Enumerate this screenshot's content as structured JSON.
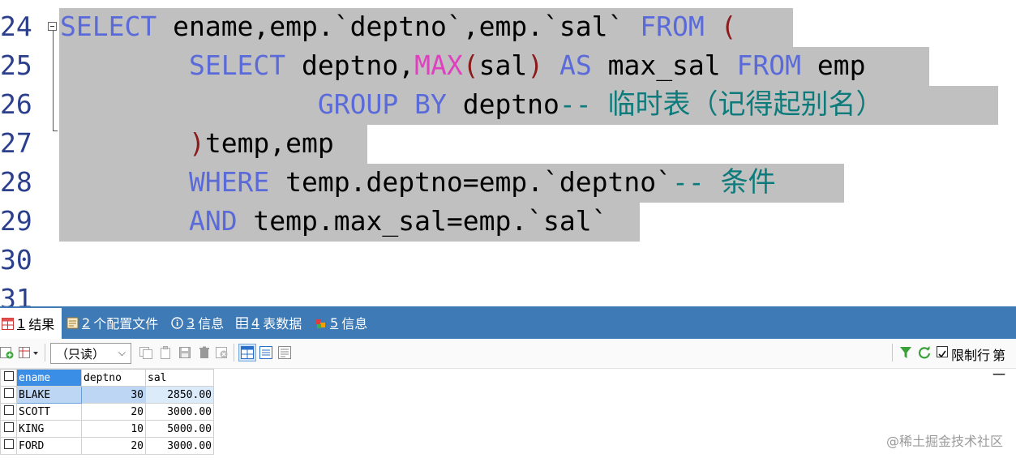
{
  "editor": {
    "line_numbers": [
      "24",
      "25",
      "26",
      "27",
      "28",
      "29",
      "30",
      "31"
    ],
    "lines": [
      [
        {
          "t": "SELECT",
          "c": "kw"
        },
        {
          "t": " ename,emp.`deptno`,emp.`sal` ",
          "c": ""
        },
        {
          "t": "FROM",
          "c": "kw"
        },
        {
          "t": " ",
          "c": ""
        },
        {
          "t": "(",
          "c": "pr"
        }
      ],
      [
        {
          "t": "        ",
          "c": ""
        },
        {
          "t": "SELECT",
          "c": "kw"
        },
        {
          "t": " deptno,",
          "c": ""
        },
        {
          "t": "MAX",
          "c": "fn"
        },
        {
          "t": "(",
          "c": "pr"
        },
        {
          "t": "sal",
          "c": ""
        },
        {
          "t": ")",
          "c": "pr"
        },
        {
          "t": " ",
          "c": ""
        },
        {
          "t": "AS",
          "c": "kw"
        },
        {
          "t": " max_sal ",
          "c": ""
        },
        {
          "t": "FROM",
          "c": "kw"
        },
        {
          "t": " emp",
          "c": ""
        }
      ],
      [
        {
          "t": "                ",
          "c": ""
        },
        {
          "t": "GROUP BY",
          "c": "kw"
        },
        {
          "t": " deptno",
          "c": ""
        },
        {
          "t": "-- ",
          "c": "cm"
        },
        {
          "t": "临时表（记得起别名）",
          "c": "cm cn"
        }
      ],
      [
        {
          "t": "        ",
          "c": ""
        },
        {
          "t": ")",
          "c": "pr"
        },
        {
          "t": "temp,emp",
          "c": ""
        }
      ],
      [
        {
          "t": "        ",
          "c": ""
        },
        {
          "t": "WHERE",
          "c": "kw"
        },
        {
          "t": " temp.deptno=emp.`deptno`",
          "c": ""
        },
        {
          "t": "-- ",
          "c": "cm"
        },
        {
          "t": "条件",
          "c": "cm cn"
        }
      ],
      [
        {
          "t": "        ",
          "c": ""
        },
        {
          "t": "AND",
          "c": "kw"
        },
        {
          "t": " temp.max_sal=emp.`sal`",
          "c": ""
        }
      ],
      [],
      []
    ]
  },
  "tabs": [
    {
      "num": "1",
      "label": "结果",
      "icon": "result-grid-icon"
    },
    {
      "num": "2",
      "label": "个配置文件",
      "icon": "profile-icon"
    },
    {
      "num": "3",
      "label": "信息",
      "icon": "info-icon"
    },
    {
      "num": "4",
      "label": "表数据",
      "icon": "table-data-icon"
    },
    {
      "num": "5",
      "label": "信息",
      "icon": "info-color-icon"
    }
  ],
  "toolbar": {
    "mode_select": "（只读）",
    "limit_label": "限制行",
    "first_label": "第一"
  },
  "grid": {
    "columns": [
      "ename",
      "deptno",
      "sal"
    ],
    "rows": [
      [
        "BLAKE",
        "30",
        "2850.00"
      ],
      [
        "SCOTT",
        "20",
        "3000.00"
      ],
      [
        "KING",
        "10",
        "5000.00"
      ],
      [
        "FORD",
        "20",
        "3000.00"
      ]
    ]
  },
  "watermark": "@稀土掘金技术社区",
  "colors": {
    "keyword": "#5a6bd9",
    "function": "#e040c0",
    "paren": "#8b1a1a",
    "comment": "#0d7b7b",
    "selection": "#c0c0c0",
    "tabbar": "#3d7ab6"
  }
}
